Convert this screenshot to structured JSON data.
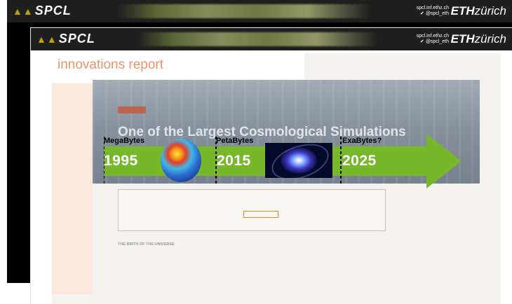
{
  "back_slide": {
    "logo": "SPCL",
    "handles": [
      "spcl.inf.ethz.ch",
      "@spcl_eth"
    ],
    "eth_prefix": "ETH",
    "eth_suffix": "zürich"
  },
  "front_slide": {
    "logo": "SPCL",
    "handles": [
      "spcl.inf.ethz.ch",
      "@spcl_eth"
    ],
    "eth_prefix": "ETH",
    "eth_suffix": "zürich"
  },
  "article": {
    "site_name": "innovations report",
    "tag": "",
    "headline": "One of the Largest Cosmological Simulations",
    "abstract_label": "",
    "abstract_text": "",
    "section_heading": "THE BIRTH OF THE UNIVERSE",
    "body_text": ""
  },
  "timeline": {
    "accent": "#76b82a",
    "stages": [
      {
        "label": "MegaBytes",
        "year": "1995"
      },
      {
        "label": "PetaBytes",
        "year": "2015"
      },
      {
        "label": "ExaBytes?",
        "year": "2025"
      }
    ]
  },
  "icons": [
    "mountain-logo-icon",
    "twitter-icon",
    "earth-image",
    "galaxy-image"
  ]
}
